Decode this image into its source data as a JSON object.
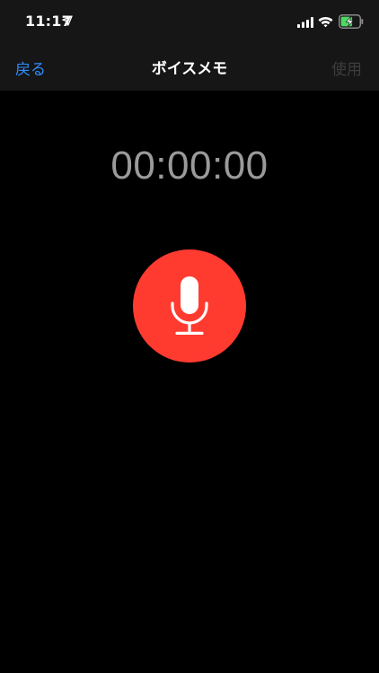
{
  "status_bar": {
    "time": "11:17",
    "icons": [
      "location-arrow-icon",
      "cellular-signal-icon",
      "wifi-icon",
      "battery-charging-icon"
    ]
  },
  "nav": {
    "back_label": "戻る",
    "title": "ボイスメモ",
    "use_label": "使用"
  },
  "recorder": {
    "elapsed": "00:00:00",
    "record_button_icon": "microphone-icon"
  },
  "colors": {
    "accent": "#2f8cff",
    "record": "#ff3b30",
    "disabled": "#3d3d3d",
    "timer": "#9a9a9a",
    "battery": "#4cd964"
  }
}
